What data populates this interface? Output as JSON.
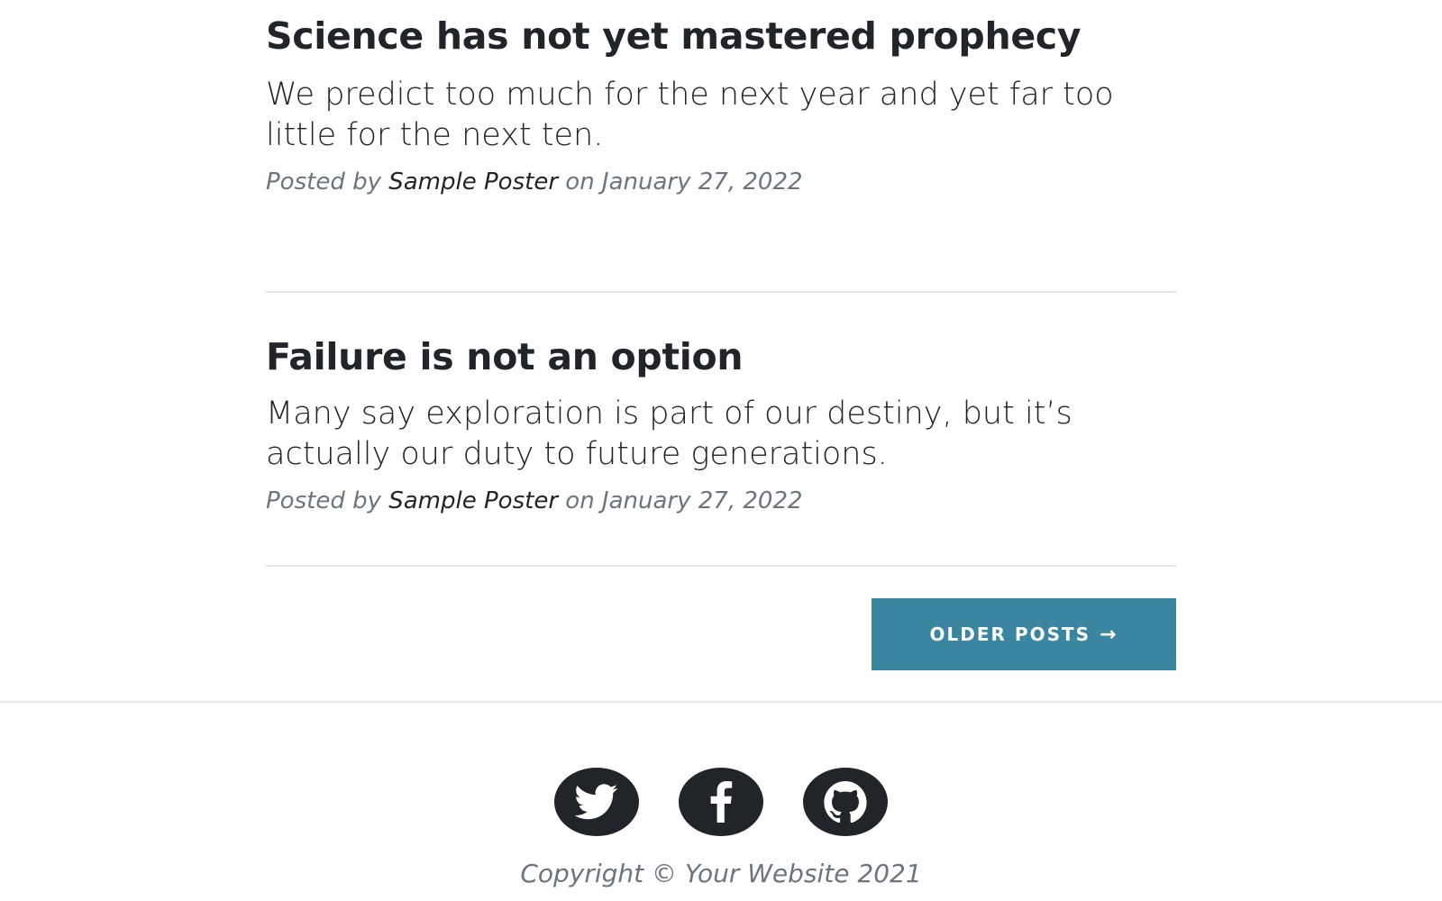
{
  "posts": [
    {
      "title": "Science has not yet mastered prophecy",
      "subtitle": "We predict too much for the next year and yet far too little for the next ten.",
      "meta_prefix": "Posted by",
      "author": "Sample Poster",
      "meta_on": "on January 27, 2022"
    },
    {
      "title": "Failure is not an option",
      "subtitle": "Many say exploration is part of our destiny, but it’s actually our duty to future generations.",
      "meta_prefix": "Posted by",
      "author": "Sample Poster",
      "meta_on": "on January 27, 2022"
    }
  ],
  "pager": {
    "older_label": "OLDER POSTS",
    "arrow": "→"
  },
  "footer": {
    "social": [
      {
        "icon": "twitter-icon"
      },
      {
        "icon": "facebook-icon"
      },
      {
        "icon": "github-icon"
      }
    ],
    "copyright": "Copyright © Your Website 2021"
  },
  "colors": {
    "button_bg": "#3a86a0",
    "text_dark": "#212529",
    "text_muted": "#6c757d",
    "divider": "#e6e6e6"
  }
}
